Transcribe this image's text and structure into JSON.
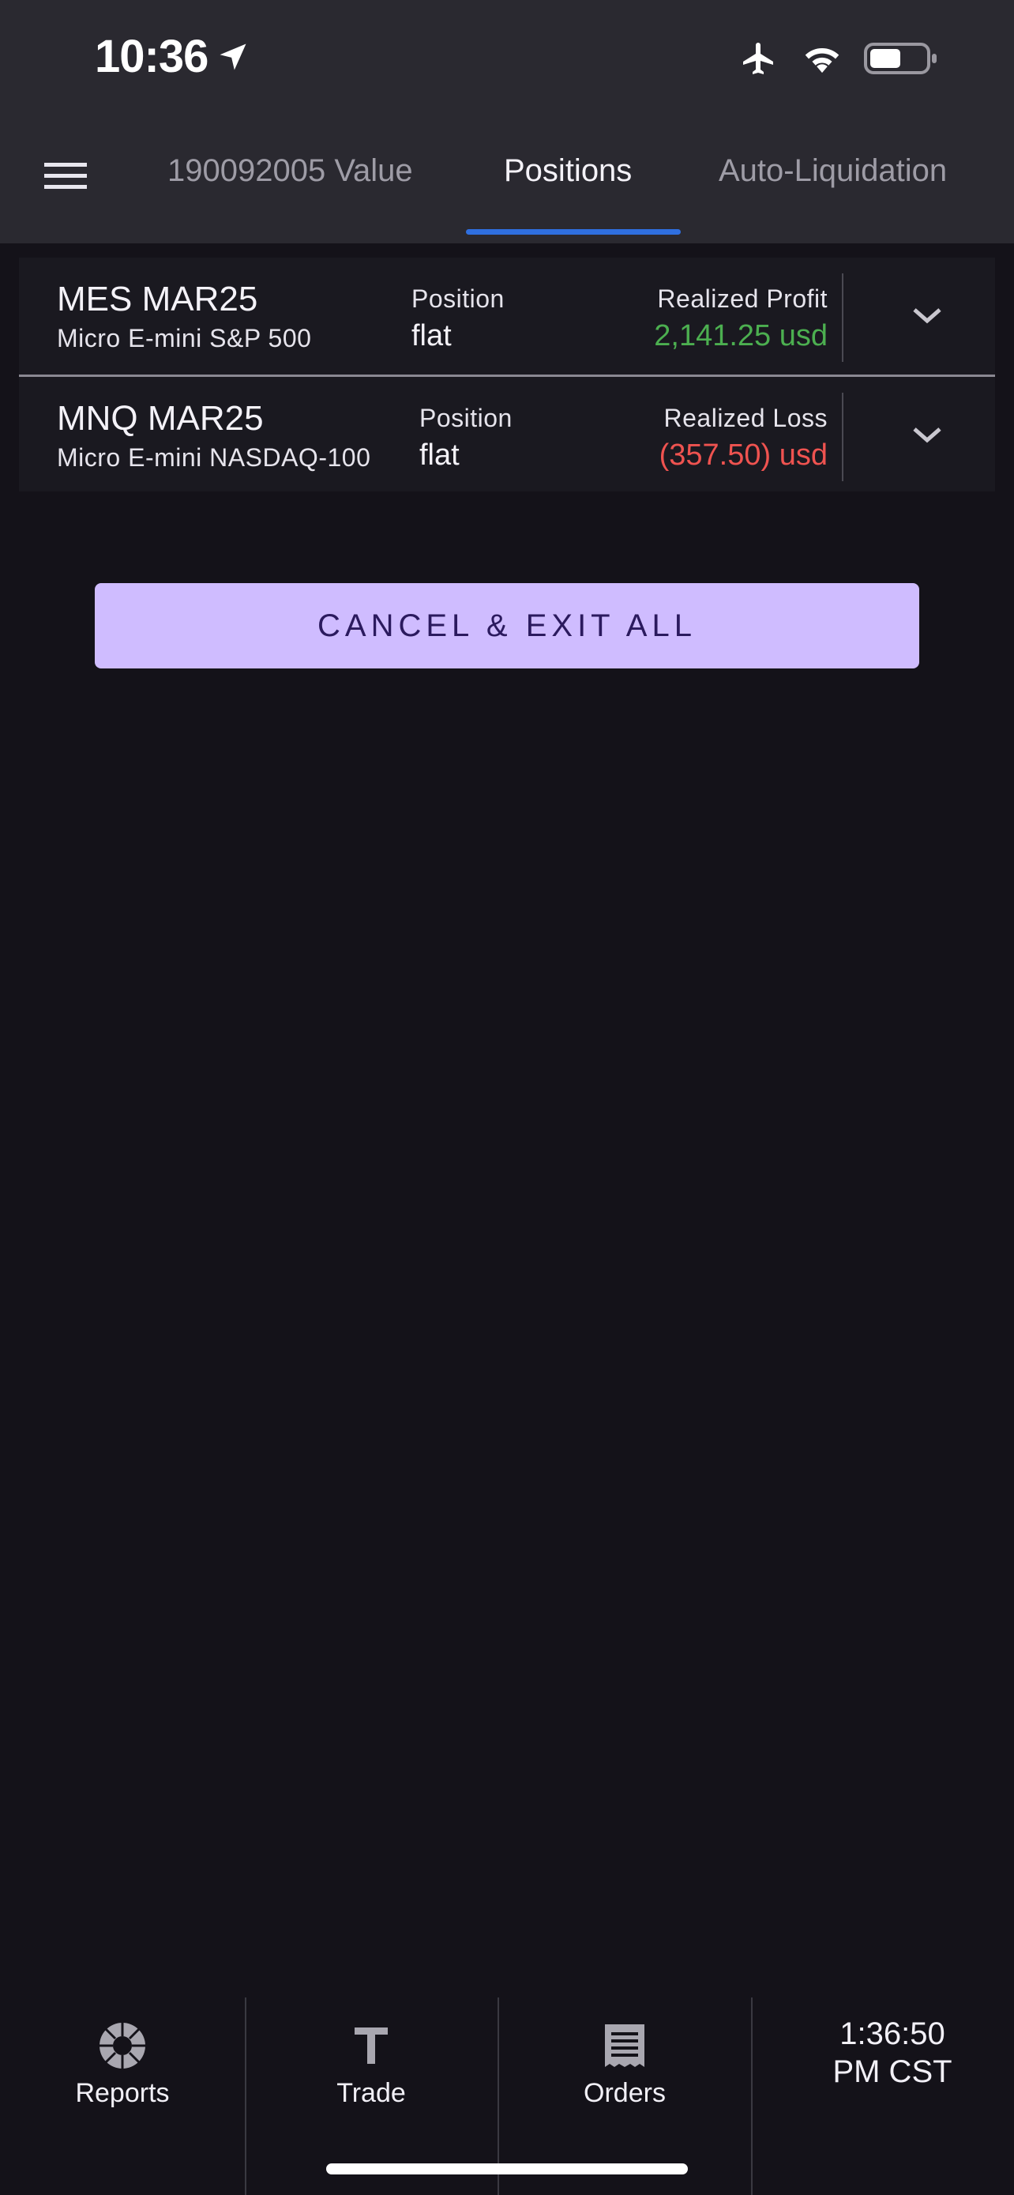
{
  "status_bar": {
    "time": "10:36",
    "icons": [
      "location-arrow-icon",
      "airplane-icon",
      "wifi-icon",
      "battery-icon"
    ]
  },
  "tabs": [
    {
      "label": "190092005 Value",
      "active": false
    },
    {
      "label": "Positions",
      "active": true
    },
    {
      "label": "Auto-Liquidation",
      "active": false
    }
  ],
  "positions": [
    {
      "symbol": "MES MAR25",
      "description": "Micro E-mini S&P 500",
      "position_label": "Position",
      "position_value": "flat",
      "pnl_label": "Realized Profit",
      "pnl_value": "2,141.25 usd",
      "pnl_color": "#4caf50"
    },
    {
      "symbol": "MNQ MAR25",
      "description": "Micro E-mini NASDAQ-100",
      "position_label": "Position",
      "position_value": "flat",
      "pnl_label": "Realized Loss",
      "pnl_value": "(357.50) usd",
      "pnl_color": "#ef5350"
    }
  ],
  "cancel_exit_label": "CANCEL & EXIT ALL",
  "bottom_nav": {
    "reports": "Reports",
    "trade": "Trade",
    "orders": "Orders",
    "clock_time": "1:36:50",
    "clock_zone": "PM CST"
  },
  "colors": {
    "accent": "#2f6fe0",
    "button": "#cfbcff",
    "profit": "#4caf50",
    "loss": "#ef5350"
  }
}
